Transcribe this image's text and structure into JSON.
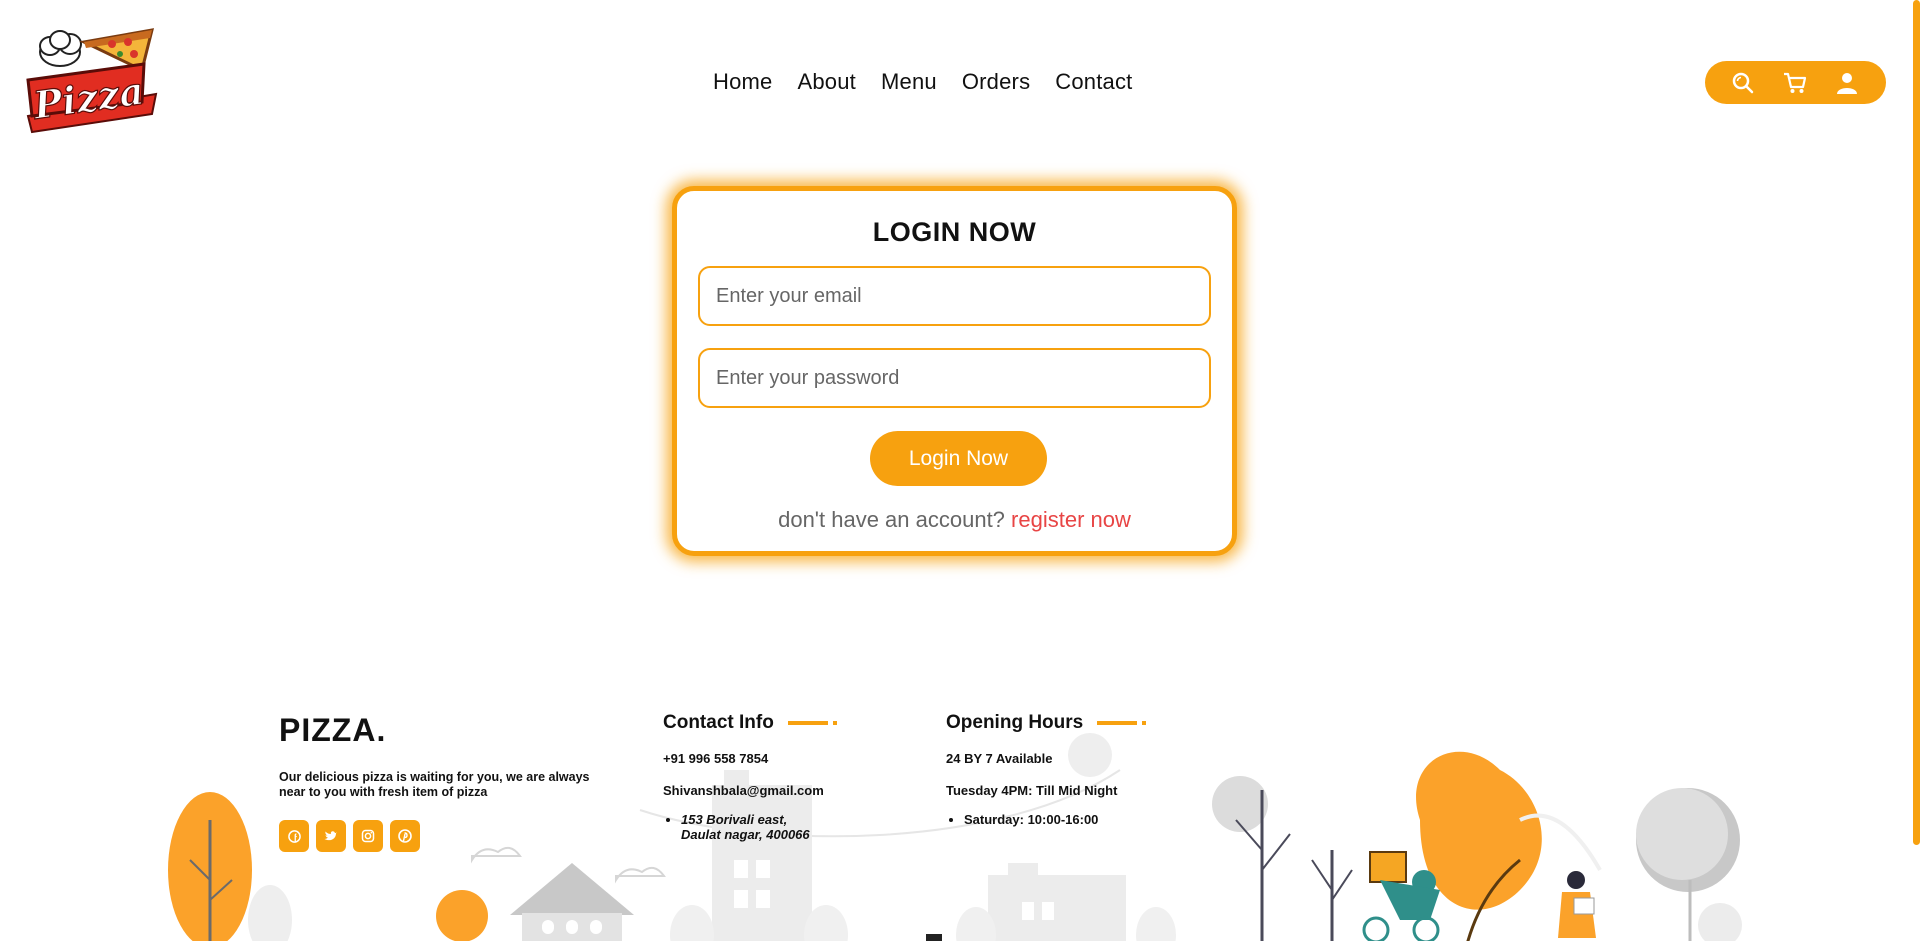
{
  "brand": {
    "logo_text": "Pizza"
  },
  "nav": {
    "items": [
      "Home",
      "About",
      "Menu",
      "Orders",
      "Contact"
    ]
  },
  "header_icons": [
    "search-icon",
    "cart-icon",
    "user-icon"
  ],
  "login": {
    "title": "LOGIN NOW",
    "email_placeholder": "Enter your email",
    "password_placeholder": "Enter your password",
    "submit_label": "Login Now",
    "register_prompt": "don't have an account?",
    "register_link": "register now"
  },
  "footer": {
    "brand": "PIZZA.",
    "description": "Our delicious pizza is waiting for you, we are always near to you with fresh item of pizza",
    "socials": [
      "facebook-icon",
      "twitter-icon",
      "instagram-icon",
      "pinterest-icon"
    ],
    "contact": {
      "heading": "Contact Info",
      "phone": "+91 996 558 7854",
      "email": "Shivanshbala@gmail.com",
      "address_line1": "153 Borivali east,",
      "address_line2": "Daulat nagar, 400066"
    },
    "hours": {
      "heading": "Opening Hours",
      "line1": "24 BY 7 Available",
      "line2": "Tuesday 4PM: Till Mid Night",
      "line3": "Saturday: 10:00-16:00"
    }
  },
  "colors": {
    "accent": "#f7a10f",
    "link": "#e84545"
  }
}
